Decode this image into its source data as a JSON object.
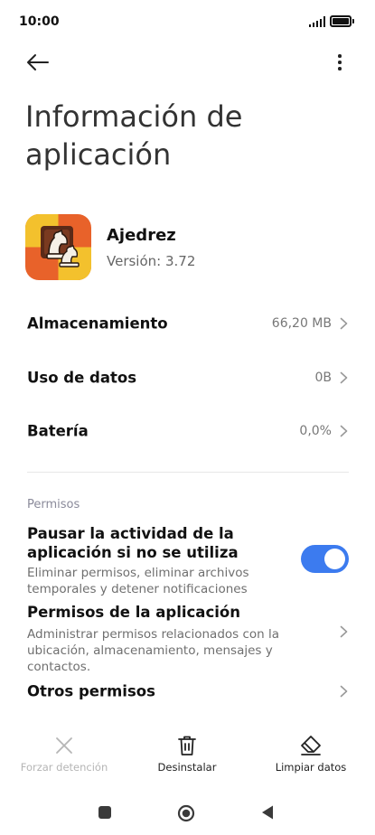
{
  "status_bar": {
    "time": "10:00",
    "signal_icon": "signal-icon",
    "battery_icon": "battery-icon"
  },
  "header": {
    "back_icon": "back-arrow-icon",
    "more_icon": "more-vert-icon",
    "title": "Información de aplicación"
  },
  "app": {
    "name": "Ajedrez",
    "version": "Versión: 3.72",
    "icon": "chess-knight-icon"
  },
  "info_rows": [
    {
      "label": "Almacenamiento",
      "value": "66,20 MB"
    },
    {
      "label": "Uso de datos",
      "value": "0B"
    },
    {
      "label": "Batería",
      "value": "0,0%"
    }
  ],
  "permissions": {
    "section_label": "Permisos",
    "pause": {
      "title": "Pausar la actividad de la aplicación si no se utiliza",
      "description": "Eliminar permisos, eliminar archivos temporales y detener notificaciones",
      "enabled": true
    },
    "app_permissions": {
      "title": "Permisos de la aplicación",
      "description": "Administrar permisos relacionados con la ubicación, almacenamiento, mensajes y contactos."
    },
    "other": {
      "title": "Otros permisos"
    }
  },
  "actions": {
    "force_stop": "Forzar detención",
    "uninstall": "Desinstalar",
    "clear_data": "Limpiar datos"
  },
  "colors": {
    "accent": "#3c7bef",
    "icon_orange": "#e8622a",
    "icon_yellow": "#f3c12d"
  }
}
